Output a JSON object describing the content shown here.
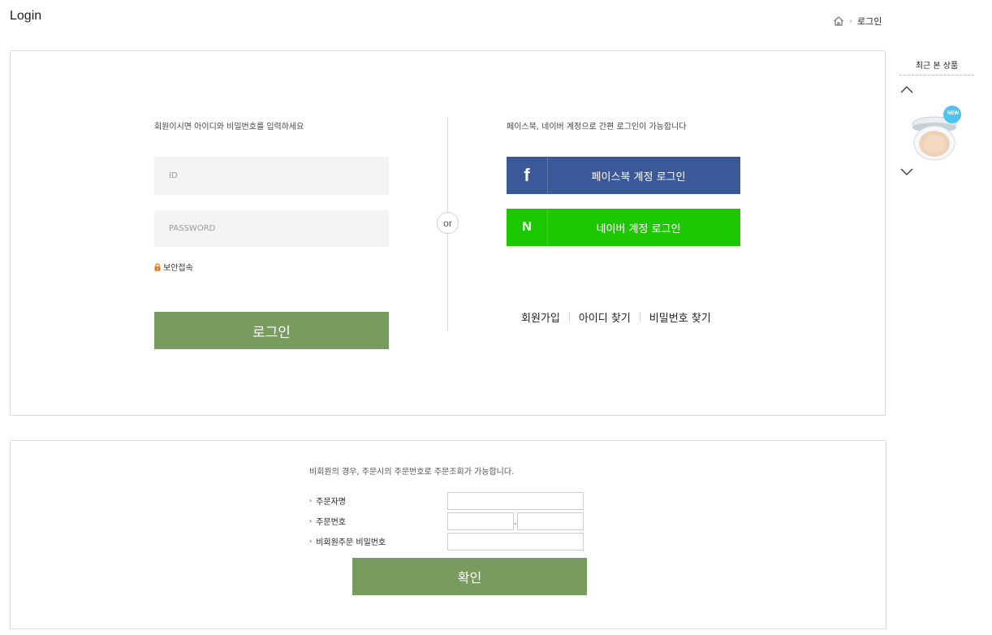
{
  "page": {
    "title": "Login"
  },
  "breadcrumb": {
    "current": "로그인",
    "separator": "›"
  },
  "login": {
    "description": "회원이시면 아이디와 비밀번호를 입력하세요",
    "id_placeholder": "ID",
    "password_placeholder": "PASSWORD",
    "secure_label": "보안접속",
    "login_label": "로그인"
  },
  "divider": {
    "or_label": "or"
  },
  "sns": {
    "description": "페이스북, 네이버 계정으로 간편 로그인이 가능합니다",
    "facebook_symbol": "f",
    "facebook_label": "페이스북 계정 로그인",
    "naver_symbol": "N",
    "naver_label": "네이버 계정 로그인",
    "links": [
      "회원가입",
      "아이디 찾기",
      "비밀번호 찾기"
    ]
  },
  "recent": {
    "title": "최근 본 상품",
    "badge": "NEW"
  },
  "guest": {
    "description": "비회원의 경우, 주문시의 주문번호로 주문조회가 가능합니다.",
    "fields": [
      "주문자명",
      "주문번호",
      "비회원주문 비밀번호"
    ],
    "order_dash": "-",
    "confirm_label": "확인"
  },
  "colors": {
    "accent_green": "#789c5f",
    "facebook_blue": "#3b5998",
    "naver_green": "#1ec800",
    "input_bg": "#f4f4f4",
    "border": "#dcdcdc"
  },
  "icons": [
    "home-icon",
    "lock-icon",
    "chevron-up-icon",
    "chevron-down-icon"
  ]
}
